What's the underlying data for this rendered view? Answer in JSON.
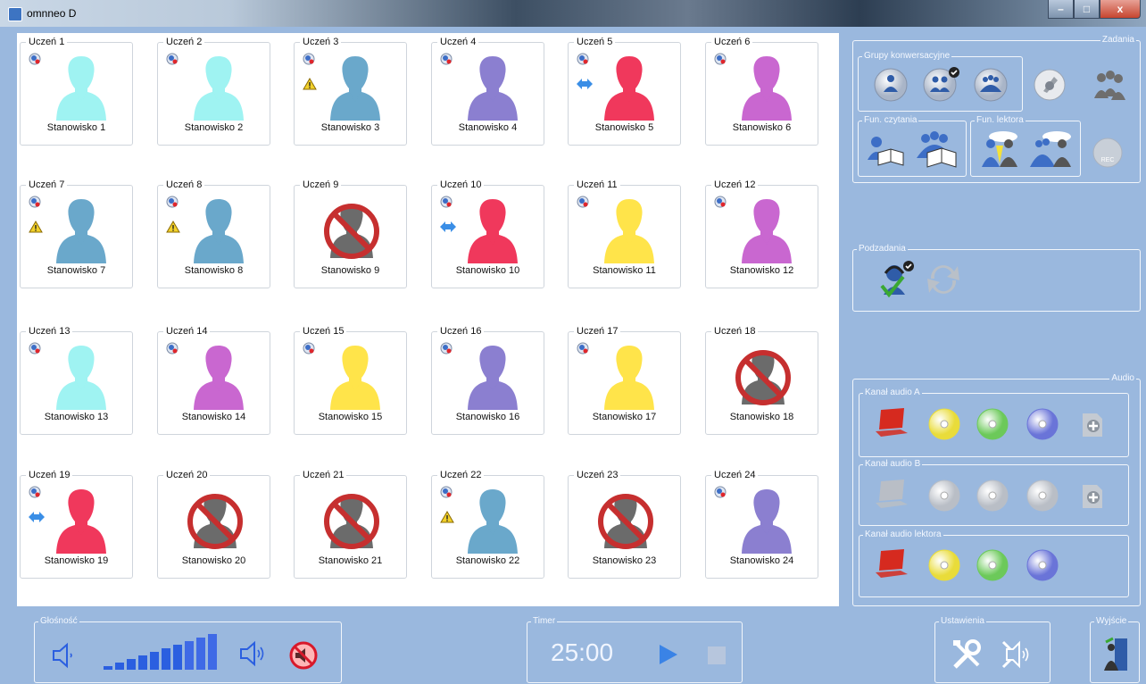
{
  "window": {
    "title": "omnneo D",
    "min": "–",
    "max": "□",
    "close": "x"
  },
  "students": [
    {
      "label": "Uczeń 1",
      "station": "Stanowisko 1",
      "color": "#9ff3f2",
      "status": "ok"
    },
    {
      "label": "Uczeń 2",
      "station": "Stanowisko 2",
      "color": "#9ff3f2",
      "status": "ok"
    },
    {
      "label": "Uczeń 3",
      "station": "Stanowisko 3",
      "color": "#6aa8cb",
      "status": "warn"
    },
    {
      "label": "Uczeń 4",
      "station": "Stanowisko 4",
      "color": "#8b7fd0",
      "status": "ok"
    },
    {
      "label": "Uczeń 5",
      "station": "Stanowisko 5",
      "color": "#f0385c",
      "status": "link"
    },
    {
      "label": "Uczeń 6",
      "station": "Stanowisko 6",
      "color": "#c967d0",
      "status": "ok"
    },
    {
      "label": "Uczeń 7",
      "station": "Stanowisko 7",
      "color": "#6aa8cb",
      "status": "warn"
    },
    {
      "label": "Uczeń 8",
      "station": "Stanowisko 8",
      "color": "#6aa8cb",
      "status": "warn"
    },
    {
      "label": "Uczeń 9",
      "station": "Stanowisko 9",
      "color": "#6b6b6b",
      "status": "off"
    },
    {
      "label": "Uczeń 10",
      "station": "Stanowisko 10",
      "color": "#f0385c",
      "status": "link"
    },
    {
      "label": "Uczeń 11",
      "station": "Stanowisko 11",
      "color": "#ffe44a",
      "status": "ok"
    },
    {
      "label": "Uczeń 12",
      "station": "Stanowisko 12",
      "color": "#c967d0",
      "status": "ok"
    },
    {
      "label": "Uczeń 13",
      "station": "Stanowisko 13",
      "color": "#9ff3f2",
      "status": "ok"
    },
    {
      "label": "Uczeń 14",
      "station": "Stanowisko 14",
      "color": "#c967d0",
      "status": "ok"
    },
    {
      "label": "Uczeń 15",
      "station": "Stanowisko 15",
      "color": "#ffe44a",
      "status": "ok"
    },
    {
      "label": "Uczeń 16",
      "station": "Stanowisko 16",
      "color": "#8b7fd0",
      "status": "ok"
    },
    {
      "label": "Uczeń 17",
      "station": "Stanowisko 17",
      "color": "#ffe44a",
      "status": "ok"
    },
    {
      "label": "Uczeń 18",
      "station": "Stanowisko 18",
      "color": "#6b6b6b",
      "status": "off"
    },
    {
      "label": "Uczeń 19",
      "station": "Stanowisko 19",
      "color": "#f0385c",
      "status": "link"
    },
    {
      "label": "Uczeń 20",
      "station": "Stanowisko 20",
      "color": "#6b6b6b",
      "status": "off"
    },
    {
      "label": "Uczeń 21",
      "station": "Stanowisko 21",
      "color": "#6b6b6b",
      "status": "off"
    },
    {
      "label": "Uczeń 22",
      "station": "Stanowisko 22",
      "color": "#6aa8cb",
      "status": "warn"
    },
    {
      "label": "Uczeń 23",
      "station": "Stanowisko 23",
      "color": "#6b6b6b",
      "status": "off"
    },
    {
      "label": "Uczeń 24",
      "station": "Stanowisko 24",
      "color": "#8b7fd0",
      "status": "ok"
    }
  ],
  "panels": {
    "zadania": "Zadania",
    "grupy": "Grupy konwersacyjne",
    "czytania": "Fun. czytania",
    "lektora": "Fun. lektora",
    "podzadania": "Podzadania",
    "audio": "Audio",
    "kanal_a": "Kanał audio A",
    "kanal_b": "Kanał audio B",
    "kanal_lektora": "Kanał audio lektora",
    "glosnosc": "Głośność",
    "timer": "Timer",
    "ustawienia": "Ustawienia",
    "wyjscie": "Wyjście",
    "rec": "REC"
  },
  "volume": {
    "level": 7,
    "max": 10
  },
  "timer": {
    "value": "25:00"
  }
}
